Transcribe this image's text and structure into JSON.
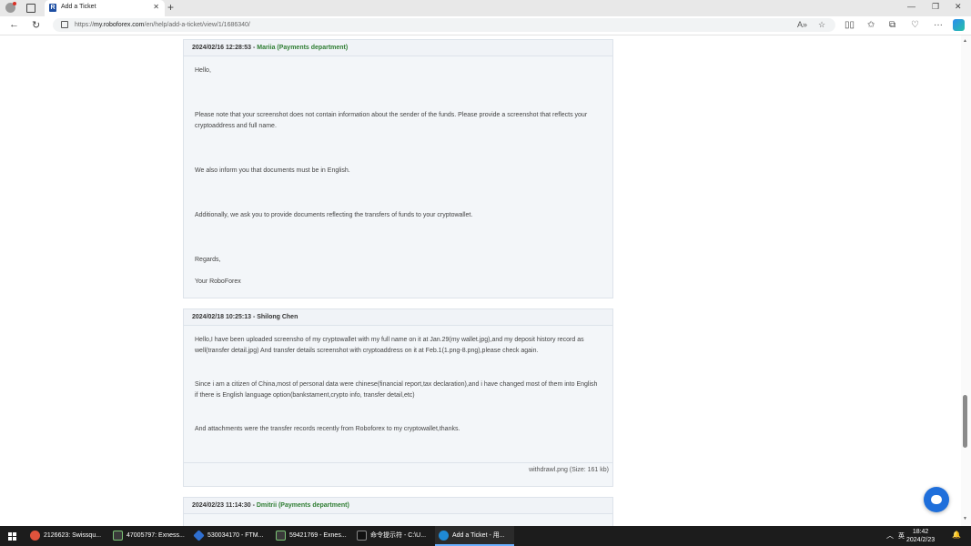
{
  "browser": {
    "tab_title": "Add a Ticket",
    "url_prefix": "https://",
    "url_host": "my.roboforex.com",
    "url_path": "/en/help/add-a-ticket/view/1/1686340/"
  },
  "messages": [
    {
      "date": "2024/02/16 12:28:53",
      "sep": " - ",
      "author": "Mariia (Payments department)",
      "paragraphs": [
        "Hello,",
        "Please note that your screenshot does not contain information about the sender of the funds. Please provide a screenshot that reflects your cryptoaddress and full name.",
        "We also inform you that documents must be in English.",
        "Additionally, we ask you to provide documents reflecting the transfers of funds to your cryptowallet.",
        "Regards,",
        "Your RoboForex"
      ]
    },
    {
      "date": "2024/02/18 10:25:13",
      "sep": " - ",
      "author": "Shilong Chen",
      "paragraphs": [
        "Hello,I have been uploaded screensho of my cryptowallet with my full name on it at Jan.29(my wallet.jpg),and my deposit history record as well(transfer detail.jpg) And transfer details screenshot with cryptoaddress on it at Feb.1(1.png-8.png),please check again.",
        "Since i am a citizen of China,most of personal data were chinese(financial report,tax declaration),and i have changed most of them into English if there is English language option(bankstament,crypto info, transfer detail,etc)",
        "And attachments were the transfer records recently from Roboforex to my cryptowallet,thanks."
      ],
      "attachment": "withdrawl.png (Size: 161 kb)"
    },
    {
      "date": "2024/02/23 11:14:30",
      "sep": " - ",
      "author": "Dmitrii (Payments department)"
    }
  ],
  "taskbar": {
    "items": [
      {
        "label": "2126623: Swissqu...",
        "color": "#e0533c"
      },
      {
        "label": "47005797: Exness...",
        "color": "#3a3a3a"
      },
      {
        "label": "530034170 - FTM...",
        "color": "#2f6fd0"
      },
      {
        "label": "59421769 - Exnes...",
        "color": "#3a3a3a"
      },
      {
        "label": "命令提示符 - C:\\U...",
        "color": "#444444"
      },
      {
        "label": "Add a Ticket - 用...",
        "color": "#1f8ad6"
      }
    ],
    "ime": "英",
    "time": "18:42",
    "date": "2024/2/23"
  },
  "colors": {
    "staff_author": "#2e7d32",
    "accent": "#1f6fdb"
  }
}
